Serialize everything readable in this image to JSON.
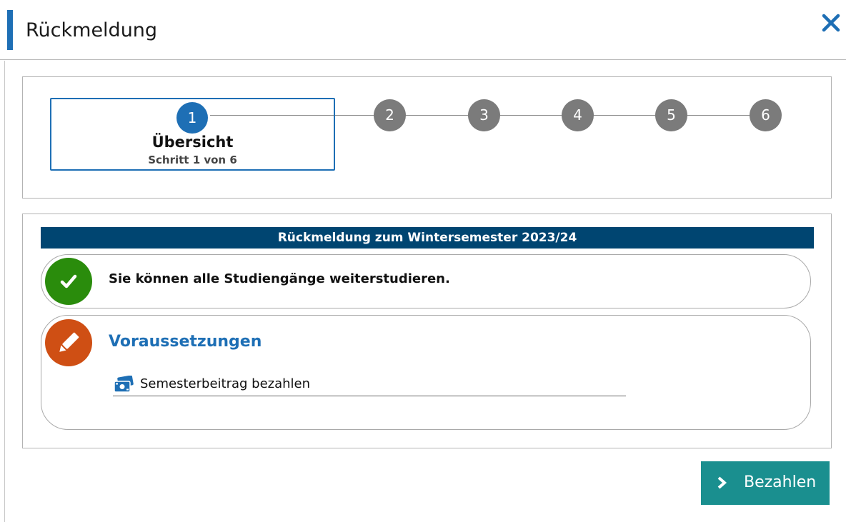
{
  "dialog": {
    "title": "Rückmeldung",
    "close_icon": "close-icon",
    "accent_color": "#1e6fb5"
  },
  "stepper": {
    "current_step": 1,
    "total_steps": 6,
    "active_label": "Übersicht",
    "active_sublabel": "Schritt 1 von 6",
    "steps": [
      "1",
      "2",
      "3",
      "4",
      "5",
      "6"
    ],
    "active_color": "#1e6fb5",
    "inactive_color": "#7b7b7b"
  },
  "section": {
    "title": "Rückmeldung zum Wintersemester 2023/24",
    "bar_color": "#004571"
  },
  "status_card": {
    "icon": "check-icon",
    "icon_color": "#2a8c0c",
    "text": "Sie können alle Studiengänge weiterstudieren."
  },
  "requirements_card": {
    "icon": "pencil-icon",
    "icon_color": "#cf4f14",
    "title": "Voraussetzungen",
    "items": [
      {
        "icon": "money-icon",
        "label": "Semesterbeitrag bezahlen"
      }
    ]
  },
  "actions": {
    "pay_label": "Bezahlen",
    "pay_icon": "chevron-right-icon",
    "pay_color": "#1a8f8f"
  }
}
